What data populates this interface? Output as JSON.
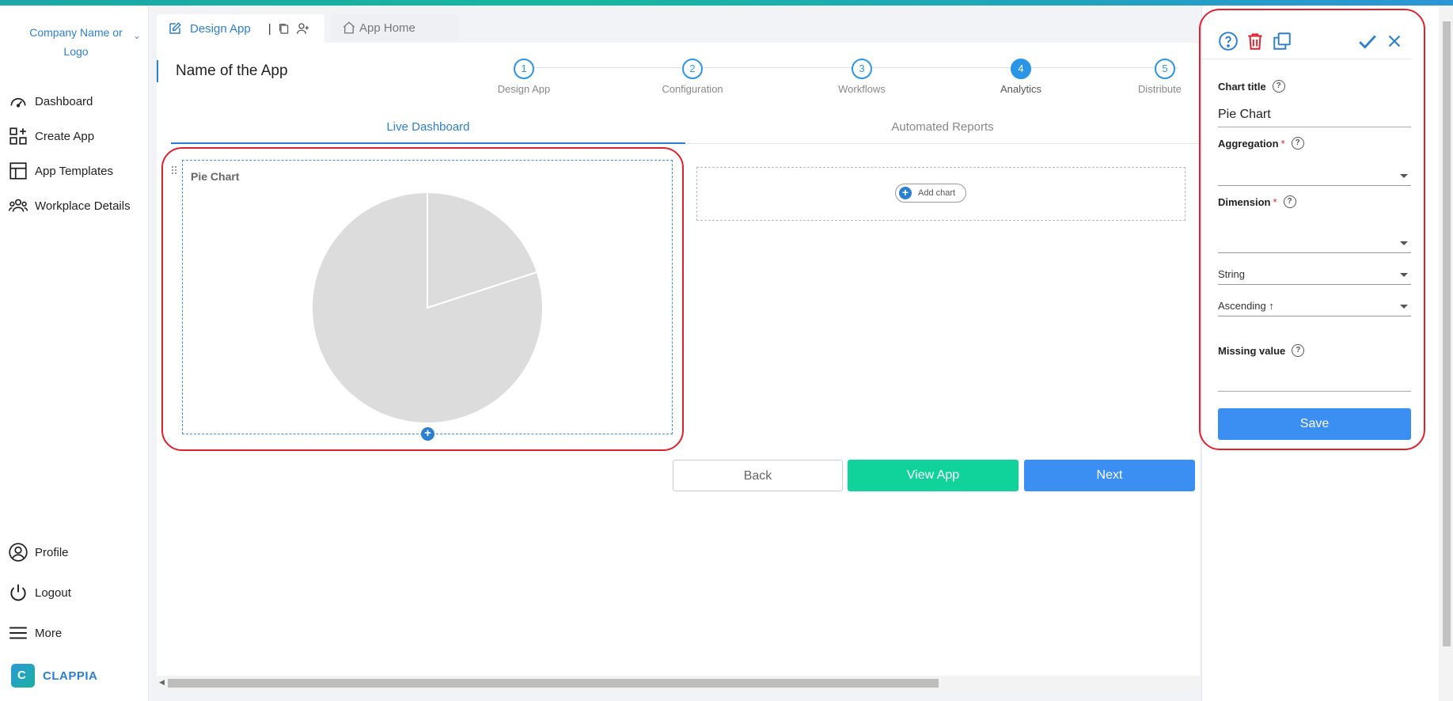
{
  "sidebar": {
    "company": "Company Name or Logo",
    "items": [
      {
        "label": "Dashboard",
        "icon": "dashboard-icon"
      },
      {
        "label": "Create App",
        "icon": "create-app-icon"
      },
      {
        "label": "App Templates",
        "icon": "templates-icon"
      },
      {
        "label": "Workplace Details",
        "icon": "team-icon"
      }
    ],
    "bottom_items": [
      {
        "label": "Profile",
        "icon": "profile-icon"
      },
      {
        "label": "Logout",
        "icon": "power-icon"
      },
      {
        "label": "More",
        "icon": "menu-icon"
      }
    ],
    "brand": "CLAPPIA"
  },
  "tabs": {
    "design_app": "Design App",
    "separator": "|",
    "app_home": "App Home"
  },
  "main": {
    "app_name": "Name of the App",
    "steps": [
      {
        "num": "1",
        "label": "Design App"
      },
      {
        "num": "2",
        "label": "Configuration"
      },
      {
        "num": "3",
        "label": "Workflows"
      },
      {
        "num": "4",
        "label": "Analytics"
      },
      {
        "num": "5",
        "label": "Distribute"
      }
    ],
    "active_step": "4",
    "view_tabs": [
      "Live Dashboard",
      "Automated Reports"
    ],
    "chart_card_title": "Pie Chart",
    "add_chart": "Add chart",
    "buttons": {
      "back": "Back",
      "view_app": "View App",
      "next": "Next"
    }
  },
  "chart_data": {
    "type": "pie",
    "values": [
      20,
      80
    ],
    "colors": [
      "#dcdcdc",
      "#dcdcdc"
    ],
    "title": "Pie Chart"
  },
  "panel": {
    "chart_title_label": "Chart title",
    "chart_title_value": "Pie Chart",
    "aggregation_label": "Aggregation",
    "aggregation_value": "",
    "dimension_label": "Dimension",
    "dimension_value": "",
    "type_value": "String",
    "sort_value": "Ascending ↑",
    "missing_label": "Missing value",
    "missing_value": "",
    "save": "Save",
    "required_mark": "*",
    "help_mark": "?"
  },
  "colors": {
    "accent": "#2b7fd0",
    "save": "#3b8ff3",
    "view_app": "#0fd39b",
    "highlight": "#e0202c",
    "delete": "#e0202c"
  }
}
